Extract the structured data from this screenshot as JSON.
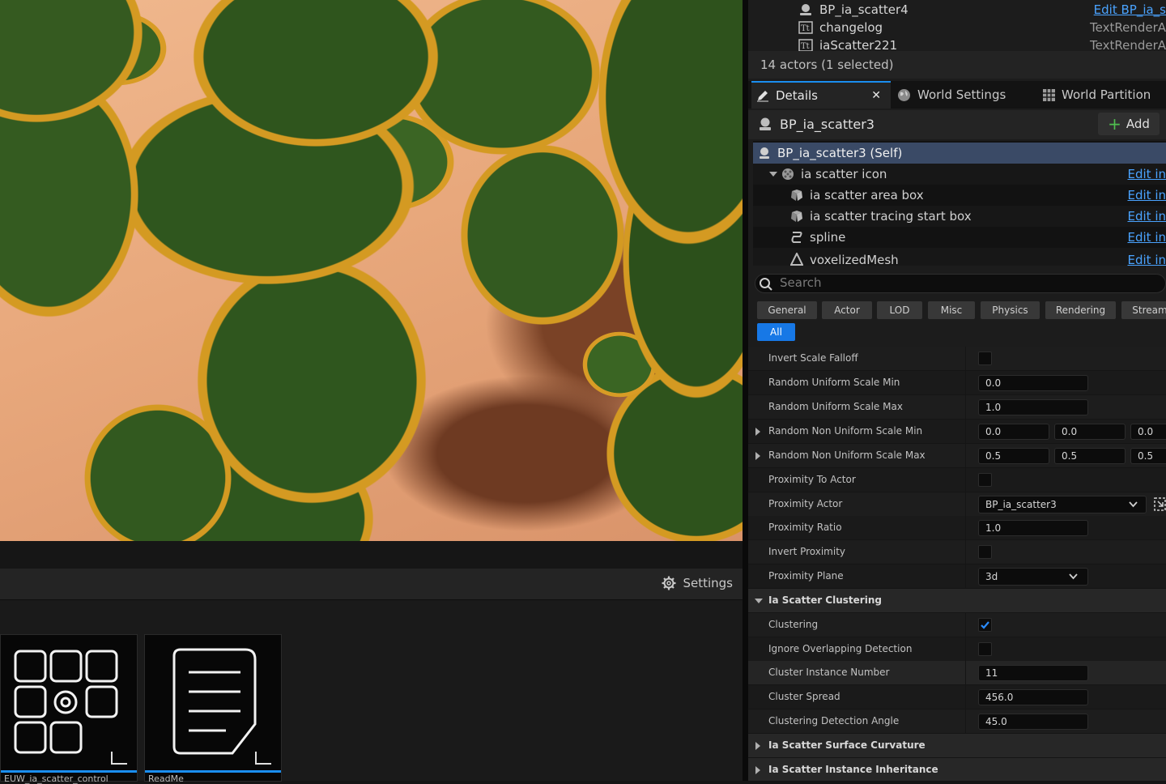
{
  "viewport": {
    "description_hidden": true
  },
  "content_browser": {
    "settings_label": "Settings",
    "assets": [
      {
        "name": "EUW_ia_scatter_control"
      },
      {
        "name": "ReadMe"
      }
    ]
  },
  "outliner": {
    "rows": [
      {
        "name": "BP_ia_scatter4",
        "type": "Edit BP_ia_s",
        "type_is_link": true,
        "icon": "actor-icon"
      },
      {
        "name": "changelog",
        "type": "TextRenderA",
        "type_is_link": false,
        "icon": "text-render-icon"
      },
      {
        "name": "iaScatter221",
        "type": "TextRenderA",
        "type_is_link": false,
        "icon": "text-render-icon"
      }
    ],
    "actor_count": "14 actors (1 selected)"
  },
  "tabs": [
    {
      "label": "Details",
      "active": true,
      "icon": "pencil-icon"
    },
    {
      "label": "World Settings",
      "active": false,
      "icon": "globe-icon"
    },
    {
      "label": "World Partition",
      "active": false,
      "icon": "grid-icon"
    }
  ],
  "details": {
    "actor_name": "BP_ia_scatter3",
    "add_label": "Add",
    "components": [
      {
        "label": "BP_ia_scatter3 (Self)",
        "edit": "",
        "selected": true
      },
      {
        "label": "ia scatter icon",
        "edit": "Edit in"
      },
      {
        "label": "ia scatter area box",
        "edit": "Edit in"
      },
      {
        "label": "ia scatter tracing start box",
        "edit": "Edit in"
      },
      {
        "label": "spline",
        "edit": "Edit in"
      },
      {
        "label": "voxelizedMesh",
        "edit": "Edit in"
      }
    ],
    "search_placeholder": "Search",
    "categories": [
      "General",
      "Actor",
      "LOD",
      "Misc",
      "Physics",
      "Rendering",
      "Stream"
    ],
    "category_all": "All",
    "properties": {
      "invert_scale_falloff": {
        "label": "Invert Scale Falloff",
        "checked": false
      },
      "random_uniform_scale_min": {
        "label": "Random Uniform Scale Min",
        "value": "0.0"
      },
      "random_uniform_scale_max": {
        "label": "Random Uniform Scale Max",
        "value": "1.0"
      },
      "random_non_uniform_scale_min": {
        "label": "Random Non Uniform Scale Min",
        "x": "0.0",
        "y": "0.0",
        "z": "0.0"
      },
      "random_non_uniform_scale_max": {
        "label": "Random Non Uniform Scale Max",
        "x": "0.5",
        "y": "0.5",
        "z": "0.5"
      },
      "proximity_to_actor": {
        "label": "Proximity To Actor",
        "checked": false
      },
      "proximity_actor": {
        "label": "Proximity Actor",
        "value": "BP_ia_scatter3"
      },
      "proximity_ratio": {
        "label": "Proximity Ratio",
        "value": "1.0"
      },
      "invert_proximity": {
        "label": "Invert Proximity",
        "checked": false
      },
      "proximity_plane": {
        "label": "Proximity Plane",
        "value": "3d"
      },
      "section_clustering": {
        "label": "Ia Scatter Clustering"
      },
      "clustering": {
        "label": "Clustering",
        "checked": true
      },
      "ignore_overlapping_detection": {
        "label": "Ignore Overlapping Detection",
        "checked": false
      },
      "cluster_instance_number": {
        "label": "Cluster Instance Number",
        "value": "11"
      },
      "cluster_spread": {
        "label": "Cluster Spread",
        "value": "456.0"
      },
      "clustering_detection_angle": {
        "label": "Clustering Detection Angle",
        "value": "45.0"
      },
      "section_surface_curvature": {
        "label": "Ia Scatter Surface Curvature"
      },
      "section_instance_inheritance": {
        "label": "Ia Scatter Instance Inheritance"
      }
    }
  },
  "colors": {
    "accent": "#1a8ef0",
    "link": "#4aa3ff",
    "selection": "#3a4a66"
  }
}
